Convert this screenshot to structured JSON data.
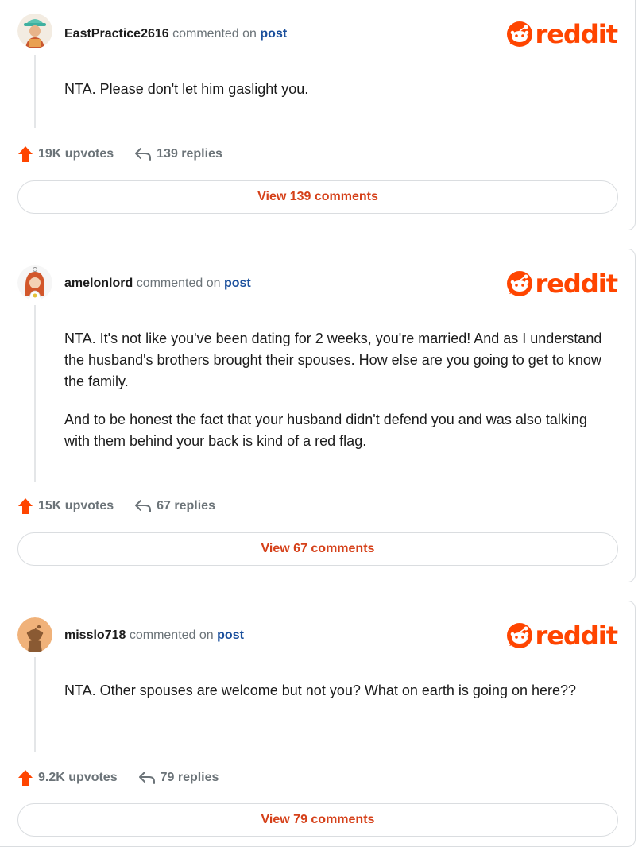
{
  "brand": {
    "name": "reddit",
    "color": "#ff4500",
    "icon": "reddit-snoo-icon"
  },
  "comments": [
    {
      "username": "EastPractice2616",
      "commented_on": "commented on",
      "post_link": "post",
      "avatar": "avatar-hat-character-icon",
      "paragraphs": [
        "NTA. Please don't let him gaslight you."
      ],
      "upvotes": "19K upvotes",
      "replies": "139 replies",
      "view_label": "View 139 comments"
    },
    {
      "username": "amelonlord",
      "commented_on": "commented on",
      "post_link": "post",
      "avatar": "avatar-redhair-character-icon",
      "paragraphs": [
        "NTA. It's not like you've been dating for 2 weeks, you're married! And as I understand the husband's brothers brought their spouses. How else are you going to get to know the family.",
        "And to be honest the fact that your husband didn't defend you and was also talking with them behind your back is kind of a red flag."
      ],
      "upvotes": "15K upvotes",
      "replies": "67 replies",
      "view_label": "View 67 comments"
    },
    {
      "username": "misslo718",
      "commented_on": "commented on",
      "post_link": "post",
      "avatar": "avatar-default-snoo-icon",
      "paragraphs": [
        "NTA. Other spouses are welcome but not you? What on earth is going on here??"
      ],
      "upvotes": "9.2K upvotes",
      "replies": "79 replies",
      "view_label": "View 79 comments"
    }
  ]
}
